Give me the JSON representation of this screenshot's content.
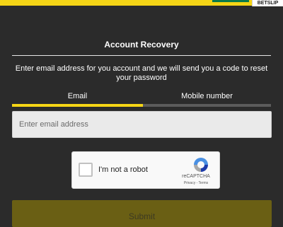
{
  "header": {
    "betslip_label": "BETSLIP"
  },
  "recovery": {
    "title": "Account Recovery",
    "instructions": "Enter email address for you account and we will send you a code to reset your password",
    "tabs": [
      {
        "label": "Email",
        "active": true
      },
      {
        "label": "Mobile number",
        "active": false
      }
    ],
    "email_field": {
      "placeholder": "Enter email address",
      "value": ""
    },
    "captcha": {
      "label": "I'm not a robot",
      "brand": "reCAPTCHA",
      "links": "Privacy - Terms",
      "icon": "recaptcha-logo-icon",
      "checked": false
    },
    "submit_label": "Submit"
  },
  "colors": {
    "accent": "#f5d516",
    "background": "#2b2b2b",
    "submit_disabled": "#6a5f14",
    "input_bg": "#eaeaea"
  }
}
